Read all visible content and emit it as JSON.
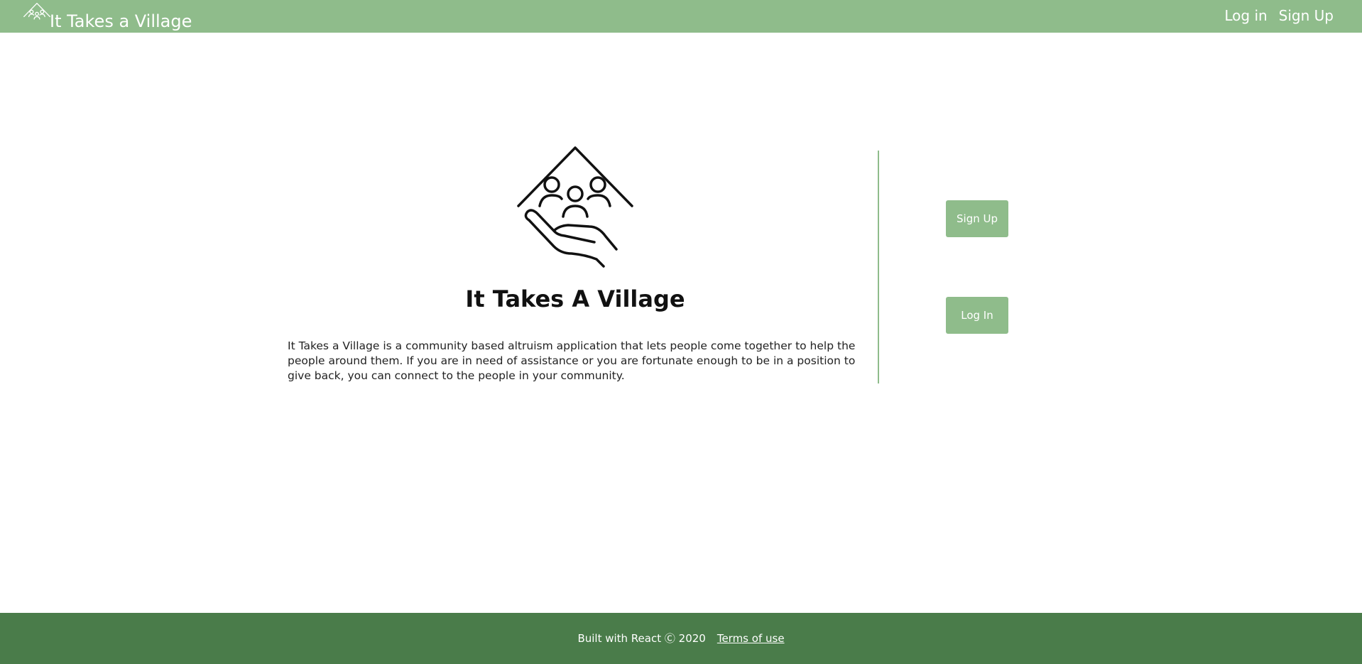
{
  "navbar": {
    "brand_name": "It Takes a Village",
    "brand_icon": "village-hand-icon",
    "links": [
      "Log in",
      "Sign Up"
    ],
    "background_color": "#8fbc8b"
  },
  "hero": {
    "logo_icon": "village-hand-icon",
    "title": "It Takes A Village",
    "description": "It Takes a Village is a community based altruism application that lets people come together to help the people around them. If you are in need of assistance or you are fortunate enough to be in a position to give back, you can connect to the people in your community."
  },
  "actions": {
    "signup_label": "Sign Up",
    "login_label": "Log In",
    "button_color": "#8fbc8b"
  },
  "footer": {
    "built_with": "Built with React Ⓒ 2020",
    "terms_label": "Terms of use",
    "background_color": "#4a7c4a"
  }
}
